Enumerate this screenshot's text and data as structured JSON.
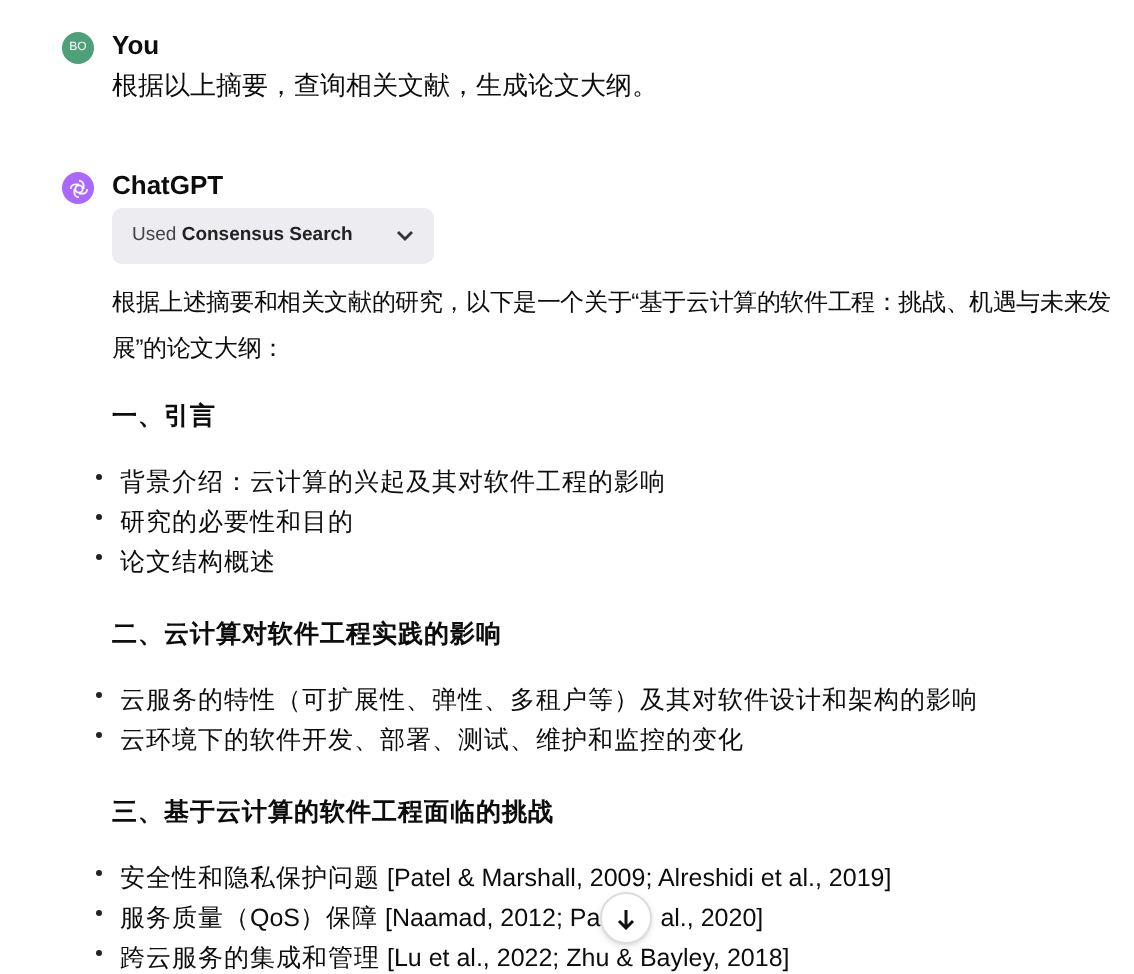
{
  "messages": [
    {
      "kind": "user",
      "avatar": "BO",
      "author": "You",
      "text": "根据以上摘要，查询相关文献，生成论文大纲。"
    },
    {
      "kind": "assistant",
      "author": "ChatGPT",
      "tool": {
        "prefix": "Used",
        "name": "Consensus Search"
      },
      "intro": "根据上述摘要和相关文献的研究，以下是一个关于“基于云计算的软件工程：挑战、机遇与未来发展”的论文大纲：",
      "sections": [
        {
          "heading": "一、引言",
          "items": [
            "背景介绍：云计算的兴起及其对软件工程的影响",
            "研究的必要性和目的",
            "论文结构概述"
          ]
        },
        {
          "heading": "二、云计算对软件工程实践的影响",
          "items": [
            "云服务的特性（可扩展性、弹性、多租户等）及其对软件设计和架构的影响",
            "云环境下的软件开发、部署、测试、维护和监控的变化"
          ]
        },
        {
          "heading": "三、基于云计算的软件工程面临的挑战",
          "items": [
            "安全性和隐私保护问题 [Patel & Marshall, 2009; Alreshidi et al., 2019]",
            {
              "text": "服务质量（QoS）保障 [Naamad, 2012; Pa",
              "after_scroll_button": "al., 2020]"
            },
            "跨云服务的集成和管理 [Lu et al., 2022; Zhu & Bayley, 2018]"
          ]
        }
      ]
    }
  ]
}
